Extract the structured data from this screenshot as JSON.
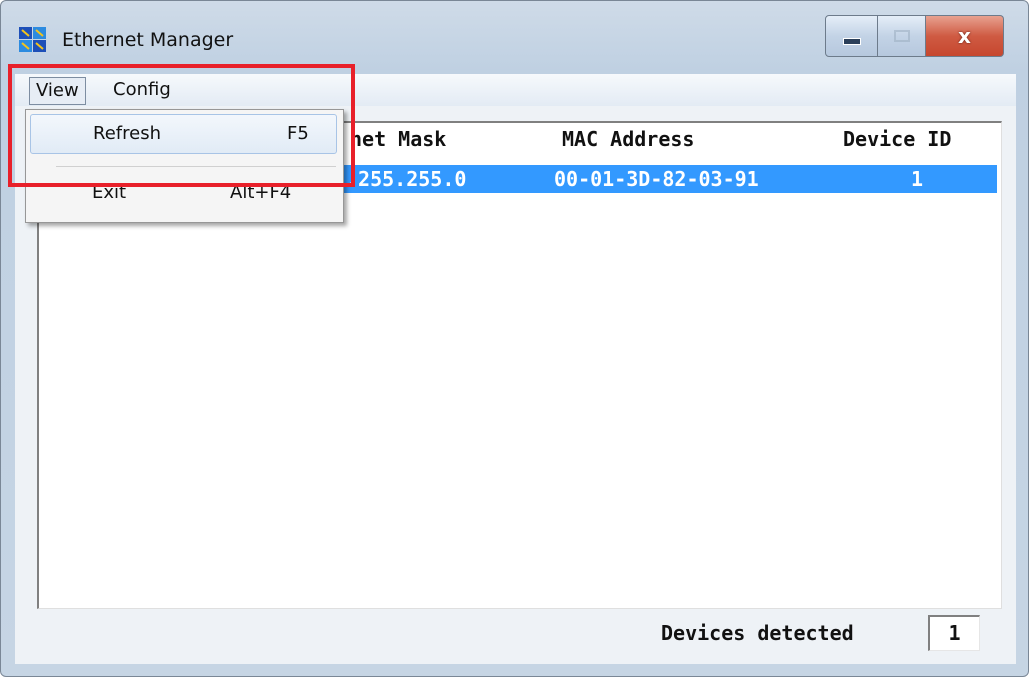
{
  "window": {
    "title": "Ethernet Manager",
    "icon": "network-app-icon"
  },
  "caption_buttons": {
    "minimize_icon": "minimize-icon",
    "maximize_icon": "maximize-icon",
    "close_icon": "close-icon",
    "close_glyph": "x"
  },
  "menubar": {
    "view_label": "View",
    "config_label": "Config"
  },
  "view_menu": {
    "refresh_label": "Refresh",
    "refresh_shortcut": "F5",
    "exit_label": "Exit",
    "exit_shortcut": "Alt+F4"
  },
  "table": {
    "headers": {
      "subnet_mask": "net Mask",
      "mac_address": "MAC Address",
      "device_id": "Device ID"
    },
    "rows": [
      {
        "subnet_mask": ".255.255.0",
        "mac_address": "00-01-3D-82-03-91",
        "device_id": "1"
      }
    ],
    "selected_row_color": "#3399ff"
  },
  "status": {
    "label": "Devices detected",
    "count": "1"
  },
  "annotation": {
    "color": "#e8202a"
  }
}
